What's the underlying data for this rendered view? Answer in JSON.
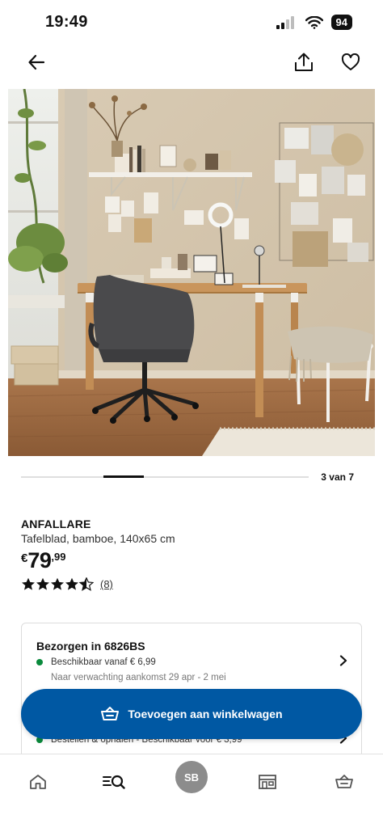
{
  "status_bar": {
    "time": "19:49",
    "battery": "94"
  },
  "product": {
    "name": "ANFALLARE",
    "description": "Tafelblad, bamboe, 140x65 cm",
    "price_currency": "€",
    "price_main": "79",
    "price_decimals": ",99",
    "rating_value": 4.5,
    "rating_max": 5,
    "review_count": "(8)"
  },
  "carousel": {
    "counter": "3 van 7",
    "current": 3,
    "total": 7
  },
  "delivery": {
    "title": "Bezorgen in 6826BS",
    "availability": "Beschikbaar vanaf € 6,99",
    "eta": "Naar verwachting aankomst 29 apr - 2 mei",
    "pickup": "Bestellen & ophalen - Beschikbaar voor € 3,99"
  },
  "cart_button": {
    "label": "Toevoegen aan winkelwagen"
  },
  "tabbar": {
    "avatar_initials": "SB"
  },
  "icons": [
    "back-arrow-icon",
    "share-icon",
    "heart-icon",
    "star-icon",
    "star-half-icon",
    "chevron-right-icon",
    "cart-icon",
    "home-icon",
    "search-icon",
    "avatar",
    "store-icon",
    "basket-icon"
  ],
  "colors": {
    "brand_blue": "#0058a3",
    "available_green": "#0a8a3c"
  }
}
